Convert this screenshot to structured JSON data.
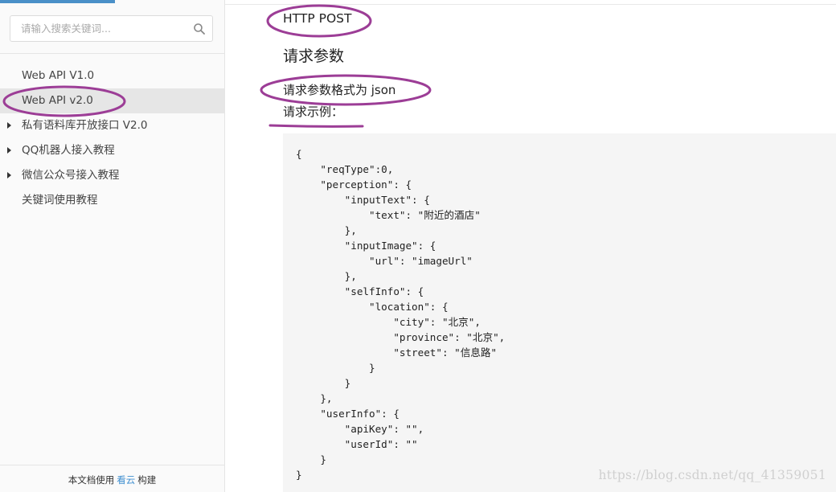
{
  "sidebar": {
    "search": {
      "placeholder": "请输入搜索关键词...",
      "value": "",
      "icon": "search-icon"
    },
    "items": [
      {
        "label": "Web API V1.0",
        "expandable": false,
        "active": false
      },
      {
        "label": "Web API v2.0",
        "expandable": false,
        "active": true
      },
      {
        "label": "私有语料库开放接口 V2.0",
        "expandable": true,
        "active": false
      },
      {
        "label": "QQ机器人接入教程",
        "expandable": true,
        "active": false
      },
      {
        "label": "微信公众号接入教程",
        "expandable": true,
        "active": false
      },
      {
        "label": "关键词使用教程",
        "expandable": false,
        "active": false
      }
    ],
    "footer": {
      "prefix": "本文档使用",
      "link": "看云",
      "suffix": "构建"
    }
  },
  "main": {
    "method": "HTTP POST",
    "section_title": "请求参数",
    "param_format": "请求参数格式为 json",
    "example_label": "请求示例：",
    "code": "{\n    \"reqType\":0,\n    \"perception\": {\n        \"inputText\": {\n            \"text\": \"附近的酒店\"\n        },\n        \"inputImage\": {\n            \"url\": \"imageUrl\"\n        },\n        \"selfInfo\": {\n            \"location\": {\n                \"city\": \"北京\",\n                \"province\": \"北京\",\n                \"street\": \"信息路\"\n            }\n        }\n    },\n    \"userInfo\": {\n        \"apiKey\": \"\",\n        \"userId\": \"\"\n    }\n}",
    "watermark": "https://blog.csdn.net/qq_41359051"
  },
  "colors": {
    "accent": "#4a90c8",
    "annotation": "#9c3d96",
    "active_bg": "#e6e6e6",
    "code_bg": "#f5f5f5"
  }
}
